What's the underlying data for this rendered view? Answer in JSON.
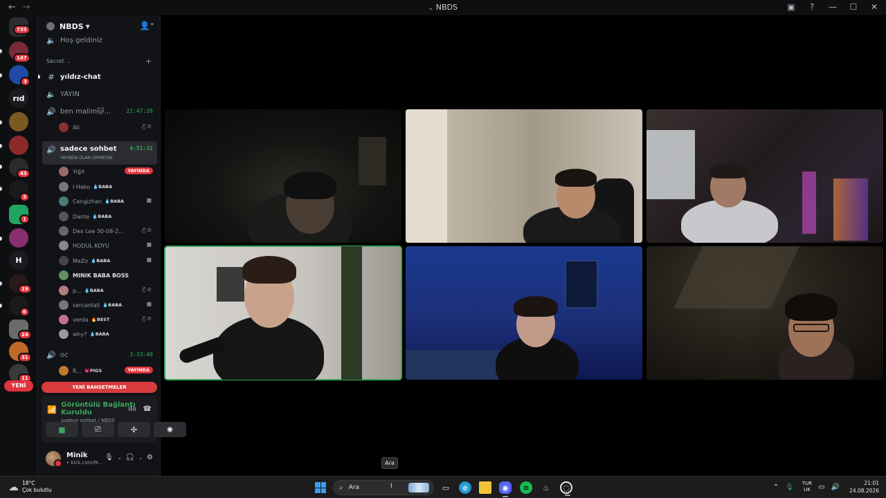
{
  "window": {
    "title": "NBDS"
  },
  "server": {
    "name": "NBDS"
  },
  "rail": {
    "top_badge": "735",
    "badges": [
      "147",
      "3",
      "43",
      "3",
      "1",
      "19",
      "6",
      "24",
      "31",
      "11"
    ],
    "text_servers": [
      "rıd",
      "H"
    ],
    "new_label": "YENİ"
  },
  "channels": {
    "welcome": "Hoş geldiniz",
    "category": "Secret",
    "text_channel": "yıldız-chat",
    "yayin": "YAYIN",
    "ben_malim": {
      "name": "ben malim🐱...",
      "time": "22:47:26"
    },
    "sadece_sohbet": {
      "name": "sadece sohbet",
      "time": "4:51:31",
      "subtitle": "YAYINDA OLAN GİRMESİN"
    },
    "oc": {
      "name": "oc",
      "time": "3:33:40"
    }
  },
  "members_ben_malim": [
    {
      "name": "Ali"
    }
  ],
  "members_sadece": [
    {
      "name": "Yiğit",
      "live": "YAYINDA"
    },
    {
      "name": "I Hako",
      "role": "BABA"
    },
    {
      "name": "Cengizhan",
      "role": "BABA"
    },
    {
      "name": "Dante",
      "role": "BABA"
    },
    {
      "name": "Dex Lee 30-08-2..."
    },
    {
      "name": "HODUL KOYU"
    },
    {
      "name": "MeZo",
      "role": "BABA"
    },
    {
      "name": "MINIK BABA BOSS"
    },
    {
      "name": "p...",
      "role": "BABA"
    },
    {
      "name": "sercantall",
      "role": "BABA"
    },
    {
      "name": "verda",
      "role": "BEST"
    },
    {
      "name": "why?",
      "role": "BABA"
    }
  ],
  "members_oc": [
    {
      "name": "R...",
      "role": "PIGS",
      "live": "YAYINDA"
    }
  ],
  "new_mentions": "YENİ BAHSETMELER",
  "voice": {
    "status": "Görüntülü Bağlantı Kuruldu",
    "location": "sadece sohbet / NBDS"
  },
  "user": {
    "name": "Minik",
    "status": "• kick.com/M..."
  },
  "tooltip": "Ara",
  "taskbar": {
    "weather_temp": "18°C",
    "weather_desc": "Çok bulutlu",
    "search_placeholder": "Ara",
    "lang_top": "TUR",
    "lang_bottom": "UK",
    "time": "21:01",
    "date": "24.08.2026"
  },
  "colors": {
    "accent_green": "#3ba55d",
    "danger_red": "#e0343c",
    "bg_dark": "#121317"
  }
}
